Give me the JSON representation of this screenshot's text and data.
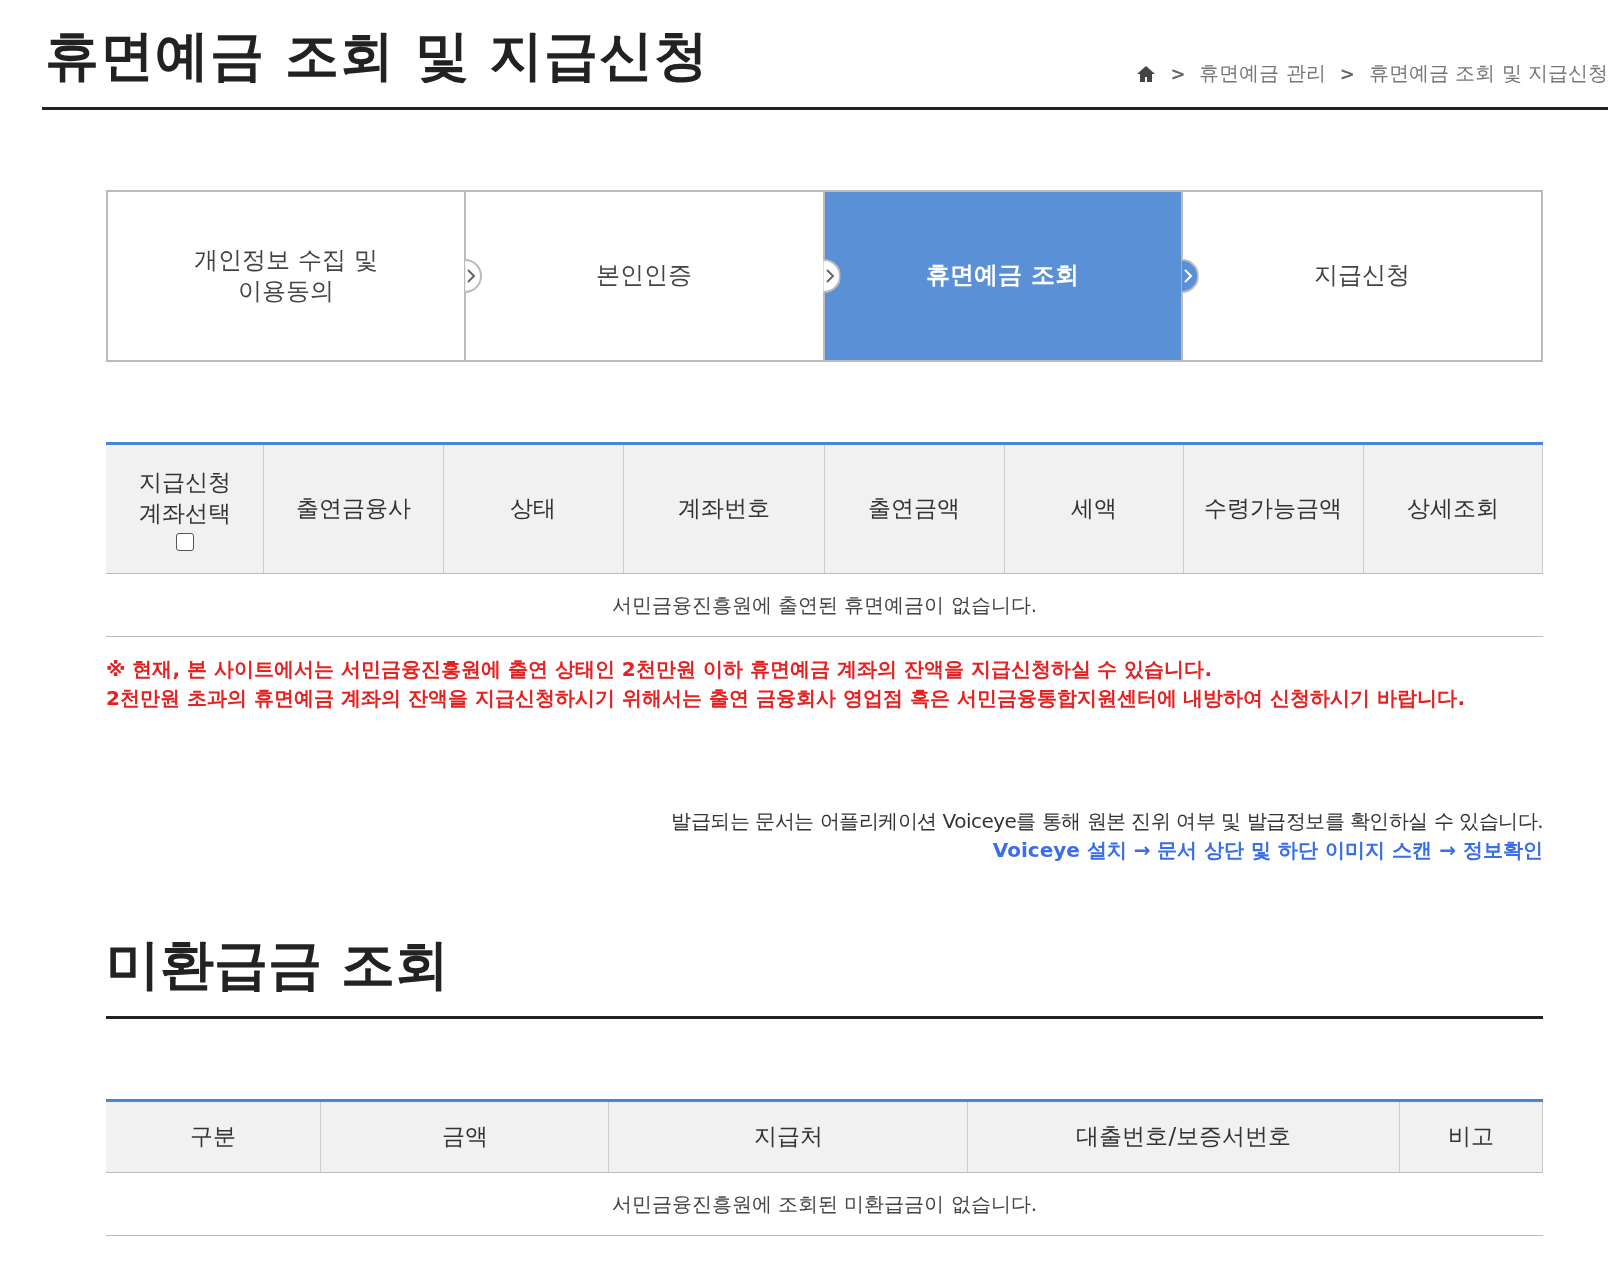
{
  "page_title": "휴면예금 조회 및 지급신청",
  "breadcrumb": [
    {
      "separator": ">",
      "label": "휴면예금 관리"
    },
    {
      "separator": ">",
      "label": "휴면예금 조회 및 지급신청"
    }
  ],
  "steps": [
    {
      "label": "개인정보 수집 및\n이용동의",
      "selected": false
    },
    {
      "label": "본인인증",
      "selected": false
    },
    {
      "label": "휴면예금 조회",
      "selected": true
    },
    {
      "label": "지급신청",
      "selected": false
    }
  ],
  "deposit_table": {
    "columns": [
      {
        "label": "지급신청\n계좌선택",
        "kind": "checkbox",
        "checked": false
      },
      {
        "label": "출연금융사",
        "kind": "text"
      },
      {
        "label": "상태",
        "kind": "text"
      },
      {
        "label": "계좌번호",
        "kind": "text"
      },
      {
        "label": "출연금액",
        "kind": "text"
      },
      {
        "label": "세액",
        "kind": "text"
      },
      {
        "label": "수령가능금액",
        "kind": "text"
      },
      {
        "label": "상세조회",
        "kind": "text"
      }
    ],
    "empty_message": "서민금융진흥원에 출연된 휴면예금이 없습니다."
  },
  "notes": [
    "※ 현재, 본 사이트에서는 서민금융진흥원에 출연 상태인 2천만원 이하 휴면예금 계좌의 잔액을 지급신청하실 수 있습니다.",
    "2천만원 초과의 휴면예금 계좌의 잔액을 지급신청하시기 위해서는 출연 금융회사 영업점 혹은 서민금융통합지원센터에 내방하여 신청하시기 바랍니다."
  ],
  "voiceye": {
    "info": "발급되는 문서는 어플리케이션 Voiceye를 통해 원본 진위 여부 및 발급정보를 확인하실 수 있습니다.",
    "guide": "Voiceye 설치 → 문서 상단 및 하단 이미지 스캔 → 정보확인"
  },
  "unpaid_section": {
    "title": "미환급금 조회",
    "columns": [
      "구분",
      "금액",
      "지급처",
      "대출번호/보증서번호",
      "비고"
    ],
    "empty_message": "서민금융진흥원에 조회된 미환급금이 없습니다."
  }
}
